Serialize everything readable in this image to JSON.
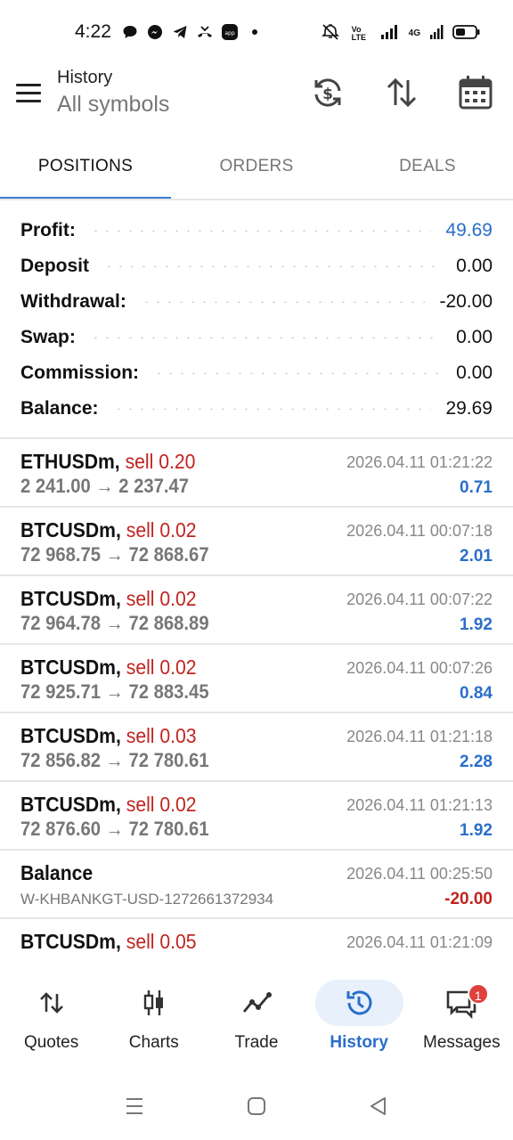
{
  "status_bar": {
    "time": "4:22",
    "network_label": "4G",
    "volte_label": "Vo LTE"
  },
  "header": {
    "title": "History",
    "subtitle": "All symbols"
  },
  "tabs": [
    {
      "label": "POSITIONS",
      "active": true
    },
    {
      "label": "ORDERS",
      "active": false
    },
    {
      "label": "DEALS",
      "active": false
    }
  ],
  "summary": [
    {
      "label": "Profit:",
      "value": "49.69"
    },
    {
      "label": "Deposit",
      "value": "0.00"
    },
    {
      "label": "Withdrawal:",
      "value": "-20.00"
    },
    {
      "label": "Swap:",
      "value": "0.00"
    },
    {
      "label": "Commission:",
      "value": "0.00"
    },
    {
      "label": "Balance:",
      "value": "29.69"
    }
  ],
  "deals": [
    {
      "symbol": "ETHUSDm,",
      "side": "sell 0.20",
      "time": "2026.04.11 01:21:22",
      "prices": "2 241.00 → 2 237.47",
      "profit": "0.71"
    },
    {
      "symbol": "BTCUSDm,",
      "side": "sell 0.02",
      "time": "2026.04.11 00:07:18",
      "prices": "72 968.75 → 72 868.67",
      "profit": "2.01"
    },
    {
      "symbol": "BTCUSDm,",
      "side": "sell 0.02",
      "time": "2026.04.11 00:07:22",
      "prices": "72 964.78 → 72 868.89",
      "profit": "1.92"
    },
    {
      "symbol": "BTCUSDm,",
      "side": "sell 0.02",
      "time": "2026.04.11 00:07:26",
      "prices": "72 925.71 → 72 883.45",
      "profit": "0.84"
    },
    {
      "symbol": "BTCUSDm,",
      "side": "sell 0.03",
      "time": "2026.04.11 01:21:18",
      "prices": "72 856.82 → 72 780.61",
      "profit": "2.28"
    },
    {
      "symbol": "BTCUSDm,",
      "side": "sell 0.02",
      "time": "2026.04.11 01:21:13",
      "prices": "72 876.60 → 72 780.61",
      "profit": "1.92"
    }
  ],
  "balance_entry": {
    "symbol": "Balance",
    "time": "2026.04.11 00:25:50",
    "comment": "W-KHBANKGT-USD-1272661372934",
    "profit": "-20.00"
  },
  "partial_deal": {
    "symbol": "BTCUSDm,",
    "side": "sell 0.05",
    "time": "2026.04.11 01:21:09"
  },
  "bottom_nav": [
    {
      "label": "Quotes",
      "icon": "quotes-icon"
    },
    {
      "label": "Charts",
      "icon": "charts-icon"
    },
    {
      "label": "Trade",
      "icon": "trade-icon"
    },
    {
      "label": "History",
      "icon": "history-icon",
      "active": true
    },
    {
      "label": "Messages",
      "icon": "messages-icon",
      "badge": "1"
    }
  ],
  "colors": {
    "accent": "#2a6fc9",
    "sell": "#c0241f",
    "tab_indicator": "#3b7dd8"
  }
}
